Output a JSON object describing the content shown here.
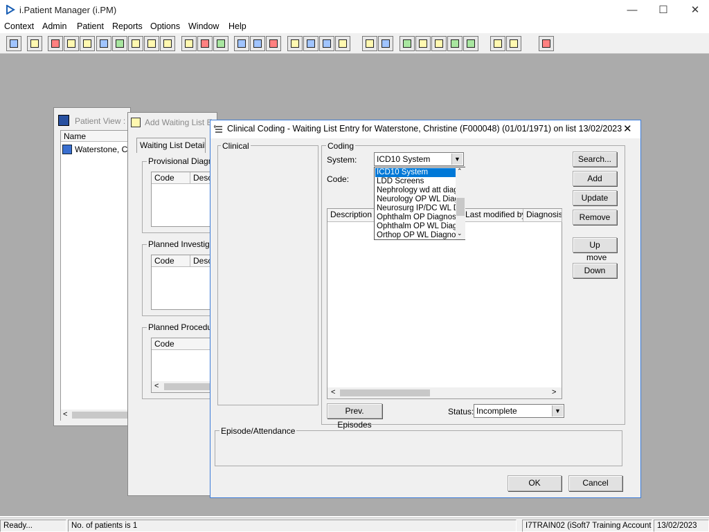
{
  "app": {
    "title": "i.Patient Manager (i.PM)",
    "minimize": "—",
    "maximize": "☐",
    "close": "✕"
  },
  "menu": [
    "Context",
    "Admin",
    "Patient",
    "Reports",
    "Options",
    "Window",
    "Help"
  ],
  "toolbar_icons": [
    "patient-icon",
    "print-icon",
    "book-icon",
    "edit-icon",
    "report-icon",
    "m-icon",
    "person-icon",
    "form-icon",
    "transfer-icon",
    "transfer2-icon",
    "search-doc-icon",
    "clock-icon",
    "screen-icon",
    "document-icon",
    "list-icon",
    "clock2-icon",
    "note-icon",
    "chart-icon",
    "transport-icon",
    "car-icon",
    "page-icon",
    "bar-chart-icon",
    "globe-icon",
    "check-list-icon",
    "check-list2-icon",
    "refresh-icon",
    "refresh2-icon",
    "swap-icon",
    "warning-icon",
    "exit-icon"
  ],
  "patient_view": {
    "title": "Patient View :",
    "column": "Name",
    "row": "Waterstone, Chr"
  },
  "add_waiting_list": {
    "title": "Add Waiting List E",
    "title_rest": "Waterstone, Christine (F000048) (01/01/1971)",
    "tab": "Waiting List Details",
    "provisional": {
      "label": "Provisional Diagno",
      "columns": [
        "Code",
        "Desc"
      ]
    },
    "investigations": {
      "label": "Planned Investigat",
      "columns": [
        "Code",
        "Desc"
      ]
    },
    "procedures": {
      "label": "Planned Procedure",
      "columns": [
        "Code"
      ]
    }
  },
  "coding_dialog": {
    "title": "Clinical Coding - Waiting List Entry for Waterstone, Christine (F000048) (01/01/1971) on list 13/02/2023",
    "clinical_label": "Clinical",
    "coding_label": "Coding",
    "system_label": "System:",
    "system_value": "ICD10 System",
    "code_label": "Code:",
    "dropdown_options": [
      "ICD10 System",
      "LDD Screens",
      "Nephrology wd att diagn",
      "Neurology OP WL Diag",
      "Neurosurg IP/DC WL D",
      "Ophthalm OP Diagnosis",
      "Ophthalm OP WL Diagn",
      "Orthop OP WL Diagnos"
    ],
    "selected_option_index": 0,
    "grid_columns": [
      "Description",
      "Last modified by",
      "Diagnosis"
    ],
    "buttons": {
      "search": "Search...",
      "add": "Add",
      "update": "Update",
      "remove": "Remove",
      "up": "Up",
      "move": "move",
      "down": "Down",
      "prev_episodes": "Prev. Episodes",
      "ok": "OK",
      "cancel": "Cancel"
    },
    "status_label": "Status:",
    "status_value": "Incomplete",
    "episode_label": "Episode/Attendance"
  },
  "statusbar": {
    "ready": "Ready...",
    "patients": "No. of patients is 1",
    "account": "I7TRAIN02 (iSoft7 Training Account)",
    "date": "13/02/2023"
  }
}
